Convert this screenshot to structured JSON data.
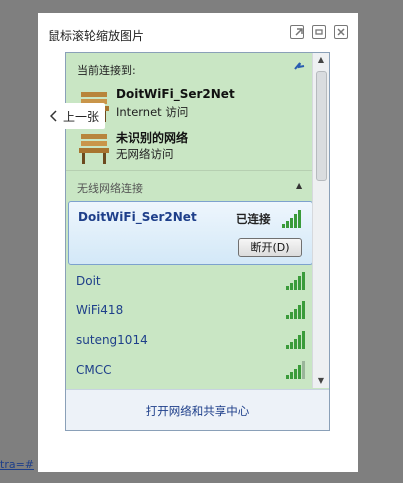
{
  "viewer": {
    "title": "鼠标滚轮缩放图片",
    "icons": [
      "external-link-icon",
      "fit-screen-icon",
      "close-icon"
    ]
  },
  "prev_button": {
    "label": "上一张",
    "icon": "chevron-left-icon"
  },
  "flyout": {
    "connected_header": "当前连接到:",
    "connected_networks": [
      {
        "name": "DoitWiFi_Ser2Net",
        "status": "Internet 访问"
      },
      {
        "name": "未识别的网络",
        "status": "无网络访问"
      }
    ],
    "wireless_header": "无线网络连接",
    "selected": {
      "name": "DoitWiFi_Ser2Net",
      "status": "已连接",
      "button_label": "断开(D)"
    },
    "networks": [
      {
        "name": "Doit",
        "signal": 5
      },
      {
        "name": "WiFi418",
        "signal": 5
      },
      {
        "name": "suteng1014",
        "signal": 5
      },
      {
        "name": "CMCC",
        "signal": 4
      }
    ],
    "footer_link": "打开网络和共享中心"
  },
  "bottom_link": "tra=#",
  "colors": {
    "link": "#1e3f8a",
    "flyout_bg": "#c9e6c4",
    "signal": "#3a9b3a"
  }
}
